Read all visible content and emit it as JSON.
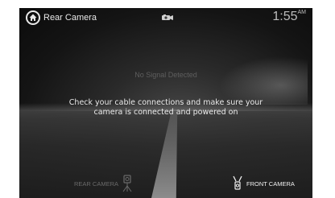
{
  "header": {
    "title": "Rear Camera",
    "time": "1:55",
    "time_suffix": "AM"
  },
  "message": {
    "no_signal": "No Signal Detected",
    "line1": "Check your cable connections and make sure your",
    "line2": "camera is connected and powered on"
  },
  "cameras": {
    "rear_label": "REAR CAMERA",
    "front_label": "FRONT CAMERA"
  },
  "icons": {
    "home": "home-icon",
    "camera_indicator": "camera-indicator-icon",
    "rear_camera": "rear-camera-icon",
    "front_camera": "front-camera-icon"
  },
  "colors": {
    "background": "#0b0b0b",
    "text_primary": "#ececec",
    "text_dim": "#6a6a6a"
  }
}
